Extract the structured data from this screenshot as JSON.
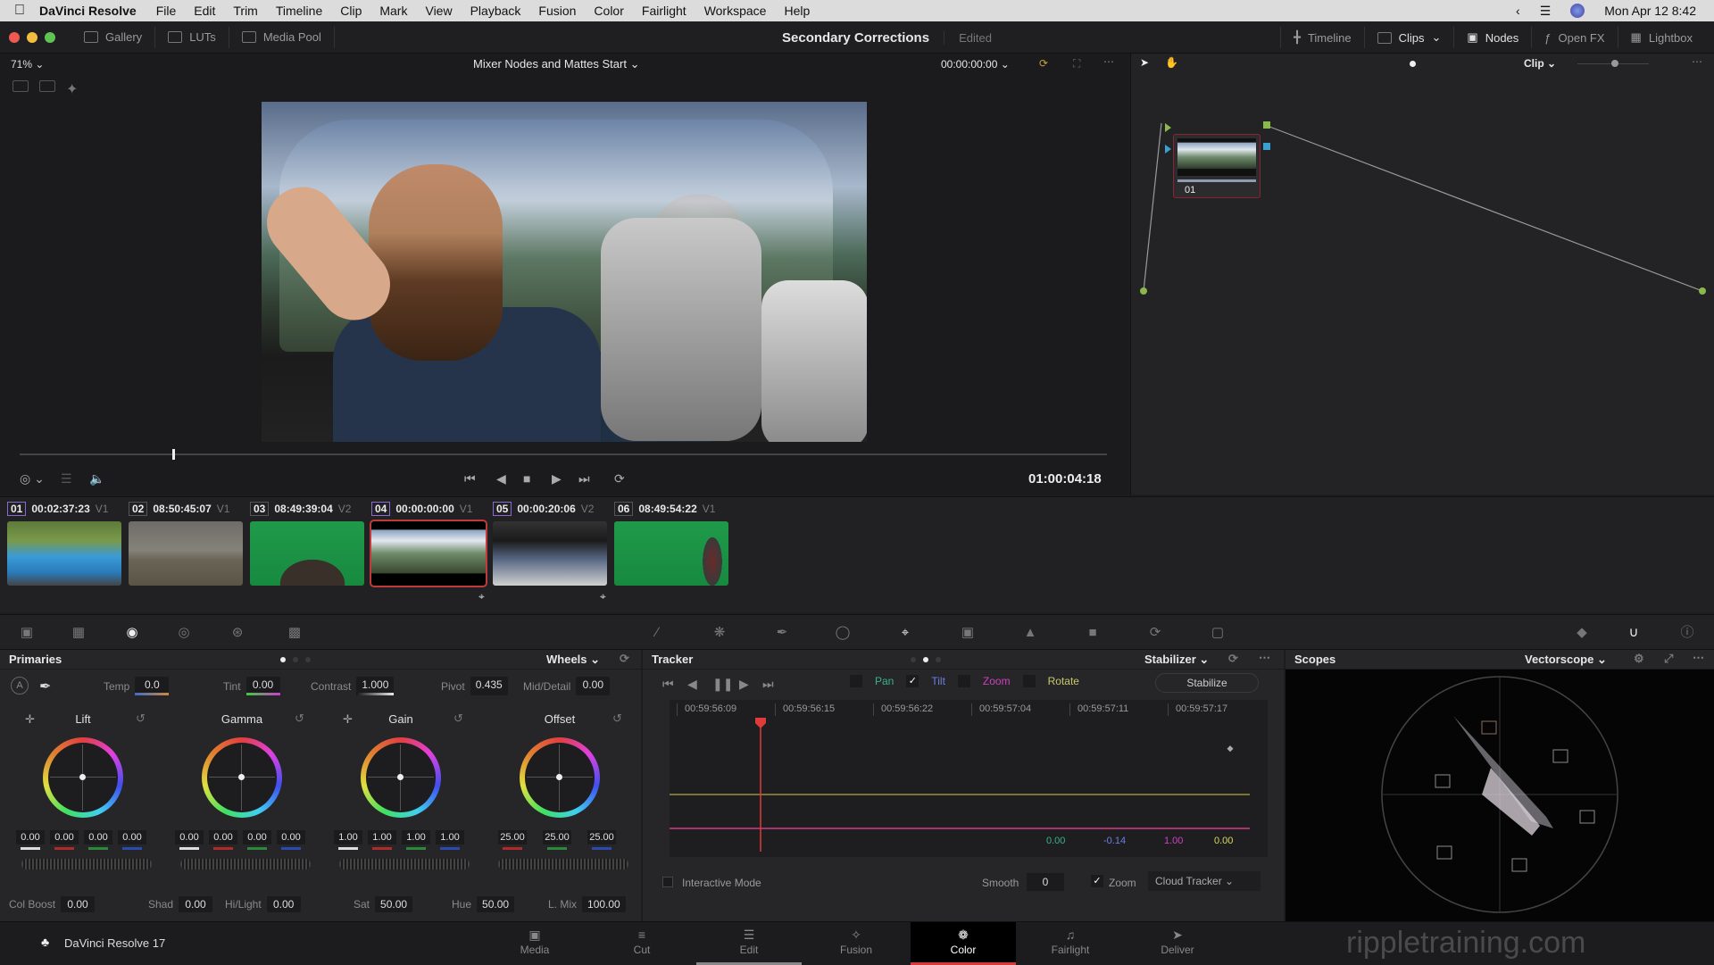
{
  "menubar": {
    "app_name": "DaVinci Resolve",
    "items": [
      "File",
      "Edit",
      "Trim",
      "Timeline",
      "Clip",
      "Mark",
      "View",
      "Playback",
      "Fusion",
      "Color",
      "Fairlight",
      "Workspace",
      "Help"
    ],
    "datetime": "Mon Apr 12  8:42"
  },
  "topbar": {
    "left_buttons": [
      "Gallery",
      "LUTs",
      "Media Pool"
    ],
    "project_title": "Secondary Corrections",
    "status": "Edited",
    "right_buttons": [
      "Timeline",
      "Clips",
      "Nodes",
      "Open FX",
      "Lightbox"
    ]
  },
  "viewer": {
    "zoom": "71%",
    "timeline_name": "Mixer Nodes and Mattes Start",
    "source_timecode": "00:00:00:00",
    "record_timecode": "01:00:04:18",
    "playhead_fraction": 0.14
  },
  "node_editor": {
    "mode": "Clip",
    "nodes": [
      {
        "label": "01"
      }
    ]
  },
  "clips": [
    {
      "num": "01",
      "timecode": "00:02:37:23",
      "track": "V1",
      "graded": true
    },
    {
      "num": "02",
      "timecode": "08:50:45:07",
      "track": "V1",
      "graded": false
    },
    {
      "num": "03",
      "timecode": "08:49:39:04",
      "track": "V2",
      "graded": false
    },
    {
      "num": "04",
      "timecode": "00:00:00:00",
      "track": "V1",
      "graded": true,
      "selected": true
    },
    {
      "num": "05",
      "timecode": "00:00:20:06",
      "track": "V2",
      "graded": true
    },
    {
      "num": "06",
      "timecode": "08:49:54:22",
      "track": "V1",
      "graded": false
    }
  ],
  "primaries": {
    "title": "Primaries",
    "mode": "Wheels",
    "top_params": [
      {
        "label": "Temp",
        "value": "0.0"
      },
      {
        "label": "Tint",
        "value": "0.00"
      },
      {
        "label": "Contrast",
        "value": "1.000"
      },
      {
        "label": "Pivot",
        "value": "0.435"
      },
      {
        "label": "Mid/Detail",
        "value": "0.00"
      }
    ],
    "wheels": [
      {
        "name": "Lift",
        "values": [
          "0.00",
          "0.00",
          "0.00",
          "0.00"
        ]
      },
      {
        "name": "Gamma",
        "values": [
          "0.00",
          "0.00",
          "0.00",
          "0.00"
        ]
      },
      {
        "name": "Gain",
        "values": [
          "1.00",
          "1.00",
          "1.00",
          "1.00"
        ]
      },
      {
        "name": "Offset",
        "values": [
          "25.00",
          "25.00",
          "25.00"
        ]
      }
    ],
    "bottom_params": [
      {
        "label": "Col Boost",
        "value": "0.00"
      },
      {
        "label": "Shad",
        "value": "0.00"
      },
      {
        "label": "Hi/Light",
        "value": "0.00"
      },
      {
        "label": "Sat",
        "value": "50.00"
      },
      {
        "label": "Hue",
        "value": "50.00"
      },
      {
        "label": "L. Mix",
        "value": "100.00"
      }
    ]
  },
  "tracker": {
    "title": "Tracker",
    "mode": "Stabilizer",
    "checks": [
      {
        "label": "Pan",
        "checked": false,
        "color": "#3bb08a"
      },
      {
        "label": "Tilt",
        "checked": true,
        "color": "#6c7fe0"
      },
      {
        "label": "Zoom",
        "checked": false,
        "color": "#d040c0"
      },
      {
        "label": "Rotate",
        "checked": false,
        "color": "#c8c86a"
      }
    ],
    "stabilize_label": "Stabilize",
    "ruler": [
      "00:59:56:09",
      "00:59:56:15",
      "00:59:56:22",
      "00:59:57:04",
      "00:59:57:11",
      "00:59:57:17"
    ],
    "readouts": [
      {
        "value": "0.00",
        "color": "#3bb08a"
      },
      {
        "value": "-0.14",
        "color": "#6c7fe0"
      },
      {
        "value": "1.00",
        "color": "#d040c0"
      },
      {
        "value": "0.00",
        "color": "#d8d860"
      }
    ],
    "interactive_mode_label": "Interactive Mode",
    "smooth_label": "Smooth",
    "smooth_value": "0",
    "zoom_label": "Zoom",
    "zoom_checked": true,
    "tracker_type": "Cloud Tracker"
  },
  "scopes": {
    "title": "Scopes",
    "type": "Vectorscope"
  },
  "bottom_nav": {
    "product": "DaVinci Resolve 17",
    "pages": [
      "Media",
      "Cut",
      "Edit",
      "Fusion",
      "Color",
      "Fairlight",
      "Deliver"
    ],
    "active": "Color"
  },
  "watermark": "rippletraining.com"
}
